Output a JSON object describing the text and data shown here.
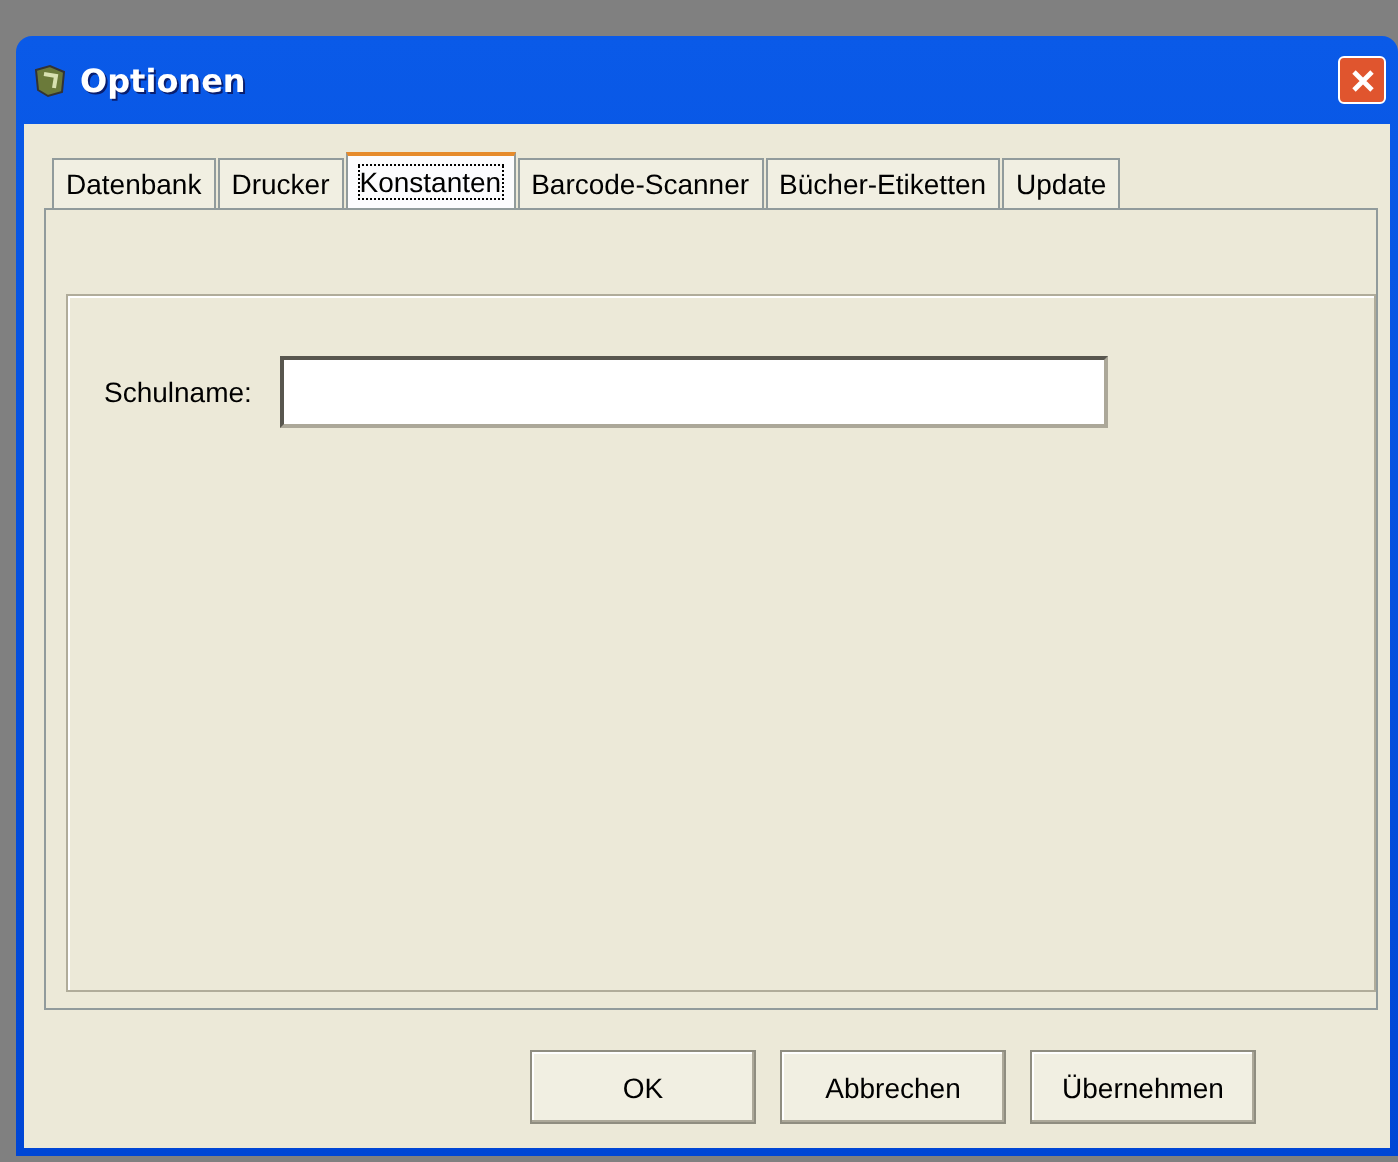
{
  "window": {
    "title": "Optionen"
  },
  "tabs": [
    {
      "label": "Datenbank",
      "selected": false
    },
    {
      "label": "Drucker",
      "selected": false
    },
    {
      "label": "Konstanten",
      "selected": true
    },
    {
      "label": "Barcode-Scanner",
      "selected": false
    },
    {
      "label": "Bücher-Etiketten",
      "selected": false
    },
    {
      "label": "Update",
      "selected": false
    }
  ],
  "form": {
    "label": "Schulname:"
  },
  "buttons": [
    "OK",
    "Abbrechen",
    "Übernehmen"
  ]
}
